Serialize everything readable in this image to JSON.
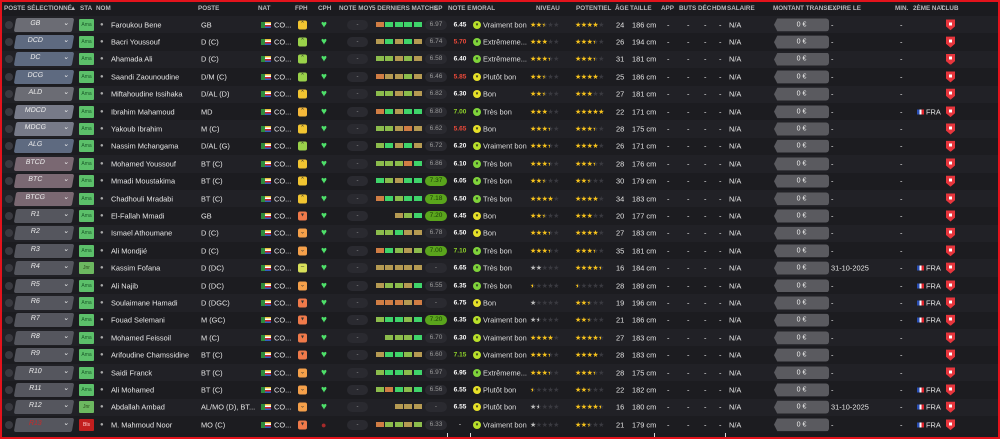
{
  "colors": {
    "frame": "#e3131c",
    "accent_green": "#5aa51c",
    "star": "#f6c21c"
  },
  "header": {
    "poste_sel": "POSTE SÉLECTIONNÉ",
    "sort": "▲",
    "sta": "STA",
    "nom": "NOM",
    "poste": "POSTE",
    "nat": "NAT",
    "fph": "FPH",
    "cph": "CPH",
    "note_moy": "NOTE MOY",
    "derniers": "5 DERNIERS MATCHS",
    "ep": "EP",
    "note_e": "NOTE E",
    "moral": "MORAL",
    "niveau": "NIVEAU",
    "potentiel": "POTENTIEL",
    "age": "ÂGE",
    "taille": "TAILLE",
    "app": "APP",
    "buts": "BUTS",
    "dec": "DÉC",
    "hdm": "HDM",
    "salaire": "SALAIRE",
    "montant": "MONTANT TRANSF...",
    "expire": "EXPIRE LE",
    "min": "MIN.",
    "nat2": "2ÈME NAT",
    "club": "CLUB"
  },
  "rows": [
    {
      "sel": "GB",
      "selc": "#6b6c74",
      "sta": "Ama",
      "nom": "Faroukou Bene",
      "poste": "GB",
      "nat": "CO...",
      "fph": "up",
      "fphc": "#f2c531",
      "cph": "heart",
      "note_moy": "-",
      "form": [
        "r",
        "g",
        "g",
        "g",
        "g"
      ],
      "ep": "6.97",
      "ep_hl": false,
      "note_e": "6.45",
      "note_c": "#fff",
      "moral": "Vraiment bon",
      "niveau": 2.5,
      "potentiel": 4,
      "age": "24",
      "taille": "186 cm",
      "app": "-",
      "buts": "-",
      "dec": "-",
      "hdm": "-",
      "salaire": "N/A",
      "montant": "0 €",
      "expire": "-",
      "min": "-",
      "nat2": ""
    },
    {
      "sel": "DCD",
      "selc": "#5e6a80",
      "sta": "Ama",
      "nom": "Bacri Youssouf",
      "poste": "D (C)",
      "nat": "CO...",
      "fph": "up",
      "fphc": "#9ad24a",
      "cph": "heart",
      "note_moy": "-",
      "form": [
        "o",
        "g",
        "o",
        "g",
        "o"
      ],
      "ep": "6.74",
      "ep_hl": false,
      "note_e": "5.70",
      "note_c": "#f04a3a",
      "moral": "Extrêmeme...",
      "niveau": 3,
      "potentiel": 3.5,
      "age": "26",
      "taille": "194 cm",
      "app": "-",
      "buts": "-",
      "dec": "-",
      "hdm": "-",
      "salaire": "N/A",
      "montant": "0 €",
      "expire": "-",
      "min": "-",
      "nat2": ""
    },
    {
      "sel": "DC",
      "selc": "#5e6a80",
      "sta": "Ama",
      "nom": "Ahamada Ali",
      "poste": "D (C)",
      "nat": "CO...",
      "fph": "up",
      "fphc": "#9ad24a",
      "cph": "heart",
      "note_moy": "-",
      "form": [
        "l",
        "l",
        "o",
        "l",
        "o"
      ],
      "ep": "6.58",
      "ep_hl": false,
      "note_e": "6.40",
      "note_c": "#fff",
      "moral": "Extrêmeme...",
      "niveau": 3.5,
      "potentiel": 3.5,
      "age": "31",
      "taille": "181 cm",
      "app": "-",
      "buts": "-",
      "dec": "-",
      "hdm": "-",
      "salaire": "N/A",
      "montant": "0 €",
      "expire": "-",
      "min": "-",
      "nat2": ""
    },
    {
      "sel": "DCG",
      "selc": "#5e6a80",
      "sta": "Ama",
      "nom": "Saandi Zaounoudine",
      "poste": "D/M (C)",
      "nat": "CO...",
      "fph": "up",
      "fphc": "#9ad24a",
      "cph": "heart",
      "note_moy": "-",
      "form": [
        "r",
        "o",
        "o",
        "l",
        "o"
      ],
      "ep": "6.46",
      "ep_hl": false,
      "note_e": "5.85",
      "note_c": "#f04a3a",
      "moral": "Plutôt bon",
      "niveau": 2.5,
      "potentiel": 4,
      "age": "25",
      "taille": "186 cm",
      "app": "-",
      "buts": "-",
      "dec": "-",
      "hdm": "-",
      "salaire": "N/A",
      "montant": "0 €",
      "expire": "-",
      "min": "-",
      "nat2": ""
    },
    {
      "sel": "ALD",
      "selc": "#6b6c74",
      "sta": "Ama",
      "nom": "Miftahoudine Issihaka",
      "poste": "D/AL (D)",
      "nat": "CO...",
      "fph": "up",
      "fphc": "#f2c531",
      "cph": "heart",
      "note_moy": "-",
      "form": [
        "l",
        "l",
        "o",
        "l",
        "o"
      ],
      "ep": "6.82",
      "ep_hl": false,
      "note_e": "6.30",
      "note_c": "#fff",
      "moral": "Bon",
      "niveau": 2.5,
      "potentiel": 3,
      "age": "27",
      "taille": "181 cm",
      "app": "-",
      "buts": "-",
      "dec": "-",
      "hdm": "-",
      "salaire": "N/A",
      "montant": "0 €",
      "expire": "-",
      "min": "-",
      "nat2": ""
    },
    {
      "sel": "MDCD",
      "selc": "#777a88",
      "sta": "Ama",
      "nom": "Ibrahim Mahamoud",
      "poste": "MD",
      "nat": "CO...",
      "fph": "up",
      "fphc": "#f5b83a",
      "cph": "heart",
      "note_moy": "-",
      "form": [
        "r",
        "g",
        "o",
        "g",
        "g"
      ],
      "ep": "6.80",
      "ep_hl": false,
      "note_e": "7.00",
      "note_c": "#8fd22a",
      "moral": "Très bon",
      "niveau": 3,
      "potentiel": 5,
      "age": "22",
      "taille": "171 cm",
      "app": "-",
      "buts": "-",
      "dec": "-",
      "hdm": "-",
      "salaire": "N/A",
      "montant": "0 €",
      "expire": "-",
      "min": "-",
      "nat2": "FRA"
    },
    {
      "sel": "MDCG",
      "selc": "#777a88",
      "sta": "Ama",
      "nom": "Yakoub Ibrahim",
      "poste": "M (C)",
      "nat": "CO...",
      "fph": "up",
      "fphc": "#f2c531",
      "cph": "heart",
      "note_moy": "-",
      "form": [
        "l",
        "l",
        "o",
        "r",
        "o"
      ],
      "ep": "6.62",
      "ep_hl": false,
      "note_e": "5.65",
      "note_c": "#f04a3a",
      "moral": "Bon",
      "niveau": 3.5,
      "potentiel": 3.5,
      "age": "28",
      "taille": "175 cm",
      "app": "-",
      "buts": "-",
      "dec": "-",
      "hdm": "-",
      "salaire": "N/A",
      "montant": "0 €",
      "expire": "-",
      "min": "-",
      "nat2": ""
    },
    {
      "sel": "ALG",
      "selc": "#5e6a80",
      "sta": "Ama",
      "nom": "Nassim Mchangama",
      "poste": "D/AL (G)",
      "nat": "CO...",
      "fph": "up",
      "fphc": "#9ad24a",
      "cph": "heart",
      "note_moy": "-",
      "form": [
        "l",
        "g",
        "o",
        "g",
        "o"
      ],
      "ep": "6.72",
      "ep_hl": false,
      "note_e": "6.20",
      "note_c": "#fff",
      "moral": "Vraiment bon",
      "niveau": 3.5,
      "potentiel": 4,
      "age": "26",
      "taille": "171 cm",
      "app": "-",
      "buts": "-",
      "dec": "-",
      "hdm": "-",
      "salaire": "N/A",
      "montant": "0 €",
      "expire": "-",
      "min": "-",
      "nat2": ""
    },
    {
      "sel": "BTCD",
      "selc": "#7a6872",
      "sta": "Ama",
      "nom": "Mohamed Youssouf",
      "poste": "BT (C)",
      "nat": "CO...",
      "fph": "up",
      "fphc": "#f2c531",
      "cph": "heart",
      "note_moy": "-",
      "form": [
        "l",
        "l",
        "l",
        "r",
        "g"
      ],
      "ep": "6.86",
      "ep_hl": false,
      "note_e": "6.10",
      "note_c": "#fff",
      "moral": "Très bon",
      "niveau": 3.5,
      "potentiel": 3.5,
      "age": "28",
      "taille": "176 cm",
      "app": "-",
      "buts": "-",
      "dec": "-",
      "hdm": "-",
      "salaire": "N/A",
      "montant": "0 €",
      "expire": "-",
      "min": "-",
      "nat2": ""
    },
    {
      "sel": "BTC",
      "selc": "#7a6872",
      "sta": "Ama",
      "nom": "Mmadi Moustakima",
      "poste": "BT (C)",
      "nat": "CO...",
      "fph": "up",
      "fphc": "#f2c531",
      "cph": "heart",
      "note_moy": "-",
      "form": [
        "g",
        "l",
        "o",
        "g",
        "g"
      ],
      "ep": "7.37",
      "ep_hl": true,
      "note_e": "6.05",
      "note_c": "#fff",
      "moral": "Très bon",
      "niveau": 2.5,
      "potentiel": 2.5,
      "age": "30",
      "taille": "179 cm",
      "app": "-",
      "buts": "-",
      "dec": "-",
      "hdm": "-",
      "salaire": "N/A",
      "montant": "0 €",
      "expire": "-",
      "min": "-",
      "nat2": ""
    },
    {
      "sel": "BTCG",
      "selc": "#7a6872",
      "sta": "Ama",
      "nom": "Chadhouli Mradabi",
      "poste": "BT (C)",
      "nat": "CO...",
      "fph": "up",
      "fphc": "#f2c531",
      "cph": "heart",
      "note_moy": "-",
      "form": [
        "r",
        "g",
        "l",
        "g",
        "g"
      ],
      "ep": "7.18",
      "ep_hl": true,
      "note_e": "6.50",
      "note_c": "#fff",
      "moral": "Très bon",
      "niveau": 4,
      "potentiel": 4,
      "age": "34",
      "taille": "183 cm",
      "app": "-",
      "buts": "-",
      "dec": "-",
      "hdm": "-",
      "salaire": "N/A",
      "montant": "0 €",
      "expire": "-",
      "min": "-",
      "nat2": ""
    },
    {
      "sel": "R1",
      "selc": "#55565e",
      "sta": "Ama",
      "nom": "El-Fallah Mmadi",
      "poste": "GB",
      "nat": "CO...",
      "fph": "thumb-down",
      "fphc": "#f07a4a",
      "cph": "heart",
      "note_moy": "-",
      "form": [
        "",
        "",
        "o",
        "l",
        "g"
      ],
      "ep": "7.20",
      "ep_hl": true,
      "note_e": "6.45",
      "note_c": "#fff",
      "moral": "Bon",
      "niveau": 2.5,
      "potentiel": 3,
      "age": "20",
      "taille": "177 cm",
      "app": "-",
      "buts": "-",
      "dec": "-",
      "hdm": "-",
      "salaire": "N/A",
      "montant": "0 €",
      "expire": "-",
      "min": "-",
      "nat2": ""
    },
    {
      "sel": "R2",
      "selc": "#55565e",
      "sta": "Ama",
      "nom": "Ismael Athoumane",
      "poste": "D (C)",
      "nat": "CO...",
      "fph": "down",
      "fphc": "#f5a04a",
      "cph": "heart",
      "note_moy": "-",
      "form": [
        "l",
        "l",
        "g",
        "o",
        "o"
      ],
      "ep": "6.78",
      "ep_hl": false,
      "note_e": "6.50",
      "note_c": "#fff",
      "moral": "Bon",
      "niveau": 3.5,
      "potentiel": 4,
      "age": "27",
      "taille": "183 cm",
      "app": "-",
      "buts": "-",
      "dec": "-",
      "hdm": "-",
      "salaire": "N/A",
      "montant": "0 €",
      "expire": "-",
      "min": "-",
      "nat2": ""
    },
    {
      "sel": "R3",
      "selc": "#55565e",
      "sta": "Ama",
      "nom": "Ali Mondjié",
      "poste": "D (C)",
      "nat": "CO...",
      "fph": "down",
      "fphc": "#f5a04a",
      "cph": "heart",
      "note_moy": "-",
      "form": [
        "r",
        "g",
        "l",
        "o",
        "l"
      ],
      "ep": "7.00",
      "ep_hl": true,
      "note_e": "7.10",
      "note_c": "#8fd22a",
      "moral": "Très bon",
      "niveau": 3.5,
      "potentiel": 3.5,
      "age": "35",
      "taille": "181 cm",
      "app": "-",
      "buts": "-",
      "dec": "-",
      "hdm": "-",
      "salaire": "N/A",
      "montant": "0 €",
      "expire": "-",
      "min": "-",
      "nat2": ""
    },
    {
      "sel": "R4",
      "selc": "#55565e",
      "sta": "Jnr",
      "nom": "Kassim Fofana",
      "poste": "D (DC)",
      "nat": "CO...",
      "fph": "flat",
      "fphc": "#d8e05a",
      "cph": "heart",
      "note_moy": "-",
      "form": [
        "o",
        "o",
        "o",
        "o",
        "o"
      ],
      "ep": "-",
      "ep_hl": false,
      "note_e": "6.65",
      "note_c": "#fff",
      "moral": "Très bon",
      "niveau": 2,
      "niveau_gray": true,
      "potentiel": 4.5,
      "age": "16",
      "taille": "184 cm",
      "app": "-",
      "buts": "-",
      "dec": "-",
      "hdm": "-",
      "salaire": "N/A",
      "montant": "0 €",
      "expire": "31-10-2025",
      "min": "-",
      "nat2": "FRA"
    },
    {
      "sel": "R5",
      "selc": "#55565e",
      "sta": "Ama",
      "nom": "Ali Najib",
      "poste": "D (DC)",
      "nat": "CO...",
      "fph": "down",
      "fphc": "#f5a04a",
      "cph": "heart",
      "note_moy": "-",
      "form": [
        "o",
        "l",
        "l",
        "o",
        "g"
      ],
      "ep": "6.55",
      "ep_hl": false,
      "note_e": "6.35",
      "note_c": "#fff",
      "moral": "Très bon",
      "niveau": 0.5,
      "potentiel": 0.5,
      "age": "28",
      "taille": "189 cm",
      "app": "-",
      "buts": "-",
      "dec": "-",
      "hdm": "-",
      "salaire": "N/A",
      "montant": "0 €",
      "expire": "-",
      "min": "-",
      "nat2": "FRA"
    },
    {
      "sel": "R6",
      "selc": "#55565e",
      "sta": "Ama",
      "nom": "Soulaimane Hamadi",
      "poste": "D (DGC)",
      "nat": "CO...",
      "fph": "thumb-down",
      "fphc": "#f07a4a",
      "cph": "heart",
      "note_moy": "-",
      "form": [
        "r",
        "r",
        "r",
        "o",
        "r"
      ],
      "ep": "-",
      "ep_hl": false,
      "note_e": "6.75",
      "note_c": "#fff",
      "moral": "Bon",
      "niveau": 1,
      "niveau_gray": true,
      "potentiel": 2.5,
      "age": "19",
      "taille": "196 cm",
      "app": "-",
      "buts": "-",
      "dec": "-",
      "hdm": "-",
      "salaire": "N/A",
      "montant": "0 €",
      "expire": "-",
      "min": "-",
      "nat2": "FRA"
    },
    {
      "sel": "R7",
      "selc": "#55565e",
      "sta": "Ama",
      "nom": "Fouad Selemani",
      "poste": "M (GC)",
      "nat": "CO...",
      "fph": "thumb-down",
      "fphc": "#f07a4a",
      "cph": "heart",
      "note_moy": "-",
      "form": [
        "l",
        "g",
        "g",
        "l",
        "g"
      ],
      "ep": "7.20",
      "ep_hl": true,
      "note_e": "6.35",
      "note_c": "#fff",
      "moral": "Vraiment bon",
      "niveau": 1.5,
      "niveau_gray": true,
      "potentiel": 2.5,
      "age": "21",
      "taille": "186 cm",
      "app": "-",
      "buts": "-",
      "dec": "-",
      "hdm": "-",
      "salaire": "N/A",
      "montant": "0 €",
      "expire": "-",
      "min": "-",
      "nat2": "FRA"
    },
    {
      "sel": "R8",
      "selc": "#55565e",
      "sta": "Ama",
      "nom": "Mohamed Feissoil",
      "poste": "M (C)",
      "nat": "CO...",
      "fph": "thumb-down",
      "fphc": "#f07a4a",
      "cph": "heart",
      "note_moy": "-",
      "form": [
        "",
        "l",
        "l",
        "l",
        "g"
      ],
      "ep": "6.70",
      "ep_hl": false,
      "note_e": "6.30",
      "note_c": "#fff",
      "moral": "Vraiment bon",
      "niveau": 4,
      "potentiel": 4.5,
      "age": "27",
      "taille": "183 cm",
      "app": "-",
      "buts": "-",
      "dec": "-",
      "hdm": "-",
      "salaire": "N/A",
      "montant": "0 €",
      "expire": "-",
      "min": "-",
      "nat2": ""
    },
    {
      "sel": "R9",
      "selc": "#55565e",
      "sta": "Ama",
      "nom": "Arifoudine Chamssidine",
      "poste": "BT (C)",
      "nat": "CO...",
      "fph": "thumb-down",
      "fphc": "#f07a4a",
      "cph": "heart",
      "note_moy": "-",
      "form": [
        "o",
        "g",
        "g",
        "l",
        "o"
      ],
      "ep": "6.60",
      "ep_hl": false,
      "note_e": "7.15",
      "note_c": "#8fd22a",
      "moral": "Vraiment bon",
      "niveau": 3.5,
      "potentiel": 4,
      "age": "28",
      "taille": "183 cm",
      "app": "-",
      "buts": "-",
      "dec": "-",
      "hdm": "-",
      "salaire": "N/A",
      "montant": "0 €",
      "expire": "-",
      "min": "-",
      "nat2": ""
    },
    {
      "sel": "R10",
      "selc": "#55565e",
      "sta": "Ama",
      "nom": "Saidi Franck",
      "poste": "BT (C)",
      "nat": "CO...",
      "fph": "down",
      "fphc": "#f5a04a",
      "cph": "heart",
      "note_moy": "-",
      "form": [
        "l",
        "g",
        "g",
        "l",
        "g"
      ],
      "ep": "6.97",
      "ep_hl": false,
      "note_e": "6.95",
      "note_c": "#fff",
      "moral": "Extrêmeme...",
      "niveau": 3.5,
      "potentiel": 3.5,
      "age": "28",
      "taille": "175 cm",
      "app": "-",
      "buts": "-",
      "dec": "-",
      "hdm": "-",
      "salaire": "N/A",
      "montant": "0 €",
      "expire": "-",
      "min": "-",
      "nat2": ""
    },
    {
      "sel": "R11",
      "selc": "#55565e",
      "sta": "Ama",
      "nom": "Ali Mohamed",
      "poste": "BT (C)",
      "nat": "CO...",
      "fph": "down",
      "fphc": "#f5a04a",
      "cph": "heart",
      "note_moy": "-",
      "form": [
        "l",
        "r",
        "g",
        "l",
        "g"
      ],
      "ep": "6.56",
      "ep_hl": false,
      "note_e": "6.55",
      "note_c": "#fff",
      "moral": "Plutôt bon",
      "niveau": 0.5,
      "potentiel": 2.5,
      "age": "22",
      "taille": "182 cm",
      "app": "-",
      "buts": "-",
      "dec": "-",
      "hdm": "-",
      "salaire": "N/A",
      "montant": "0 €",
      "expire": "-",
      "min": "-",
      "nat2": "FRA"
    },
    {
      "sel": "R12",
      "selc": "#55565e",
      "sta": "Jnr",
      "nom": "Abdallah Ambad",
      "poste": "AL/MO (D), BT...",
      "nat": "CO...",
      "fph": "down",
      "fphc": "#f5a04a",
      "cph": "heart",
      "note_moy": "-",
      "form": [
        "",
        "",
        "o",
        "o",
        "o"
      ],
      "ep": "-",
      "ep_hl": false,
      "note_e": "6.55",
      "note_c": "#fff",
      "moral": "Plutôt bon",
      "niveau": 1.5,
      "niveau_gray": true,
      "potentiel": 4.5,
      "age": "16",
      "taille": "180 cm",
      "app": "-",
      "buts": "-",
      "dec": "-",
      "hdm": "-",
      "salaire": "N/A",
      "montant": "0 €",
      "expire": "31-10-2025",
      "min": "-",
      "nat2": "FRA"
    },
    {
      "sel": "R13",
      "selc": "#55565e",
      "sel_text": "#c82a2a",
      "sta": "Bls",
      "nom": "M. Mahmoud Noor",
      "poste": "MO (C)",
      "nat": "CO...",
      "fph": "thumb-down",
      "fphc": "#f07a4a",
      "cph": "injury-dot",
      "note_moy": "-",
      "form": [
        "r",
        "l",
        "l",
        "o",
        "l"
      ],
      "ep": "6.33",
      "ep_hl": false,
      "note_e": "-",
      "note_c": "#aaa",
      "moral": "Vraiment bon",
      "niveau": 1,
      "niveau_gray": true,
      "potentiel": 2.5,
      "age": "21",
      "taille": "179 cm",
      "app": "-",
      "buts": "-",
      "dec": "-",
      "hdm": "-",
      "salaire": "N/A",
      "montant": "0 €",
      "expire": "-",
      "min": "-",
      "nat2": "FRA"
    }
  ]
}
